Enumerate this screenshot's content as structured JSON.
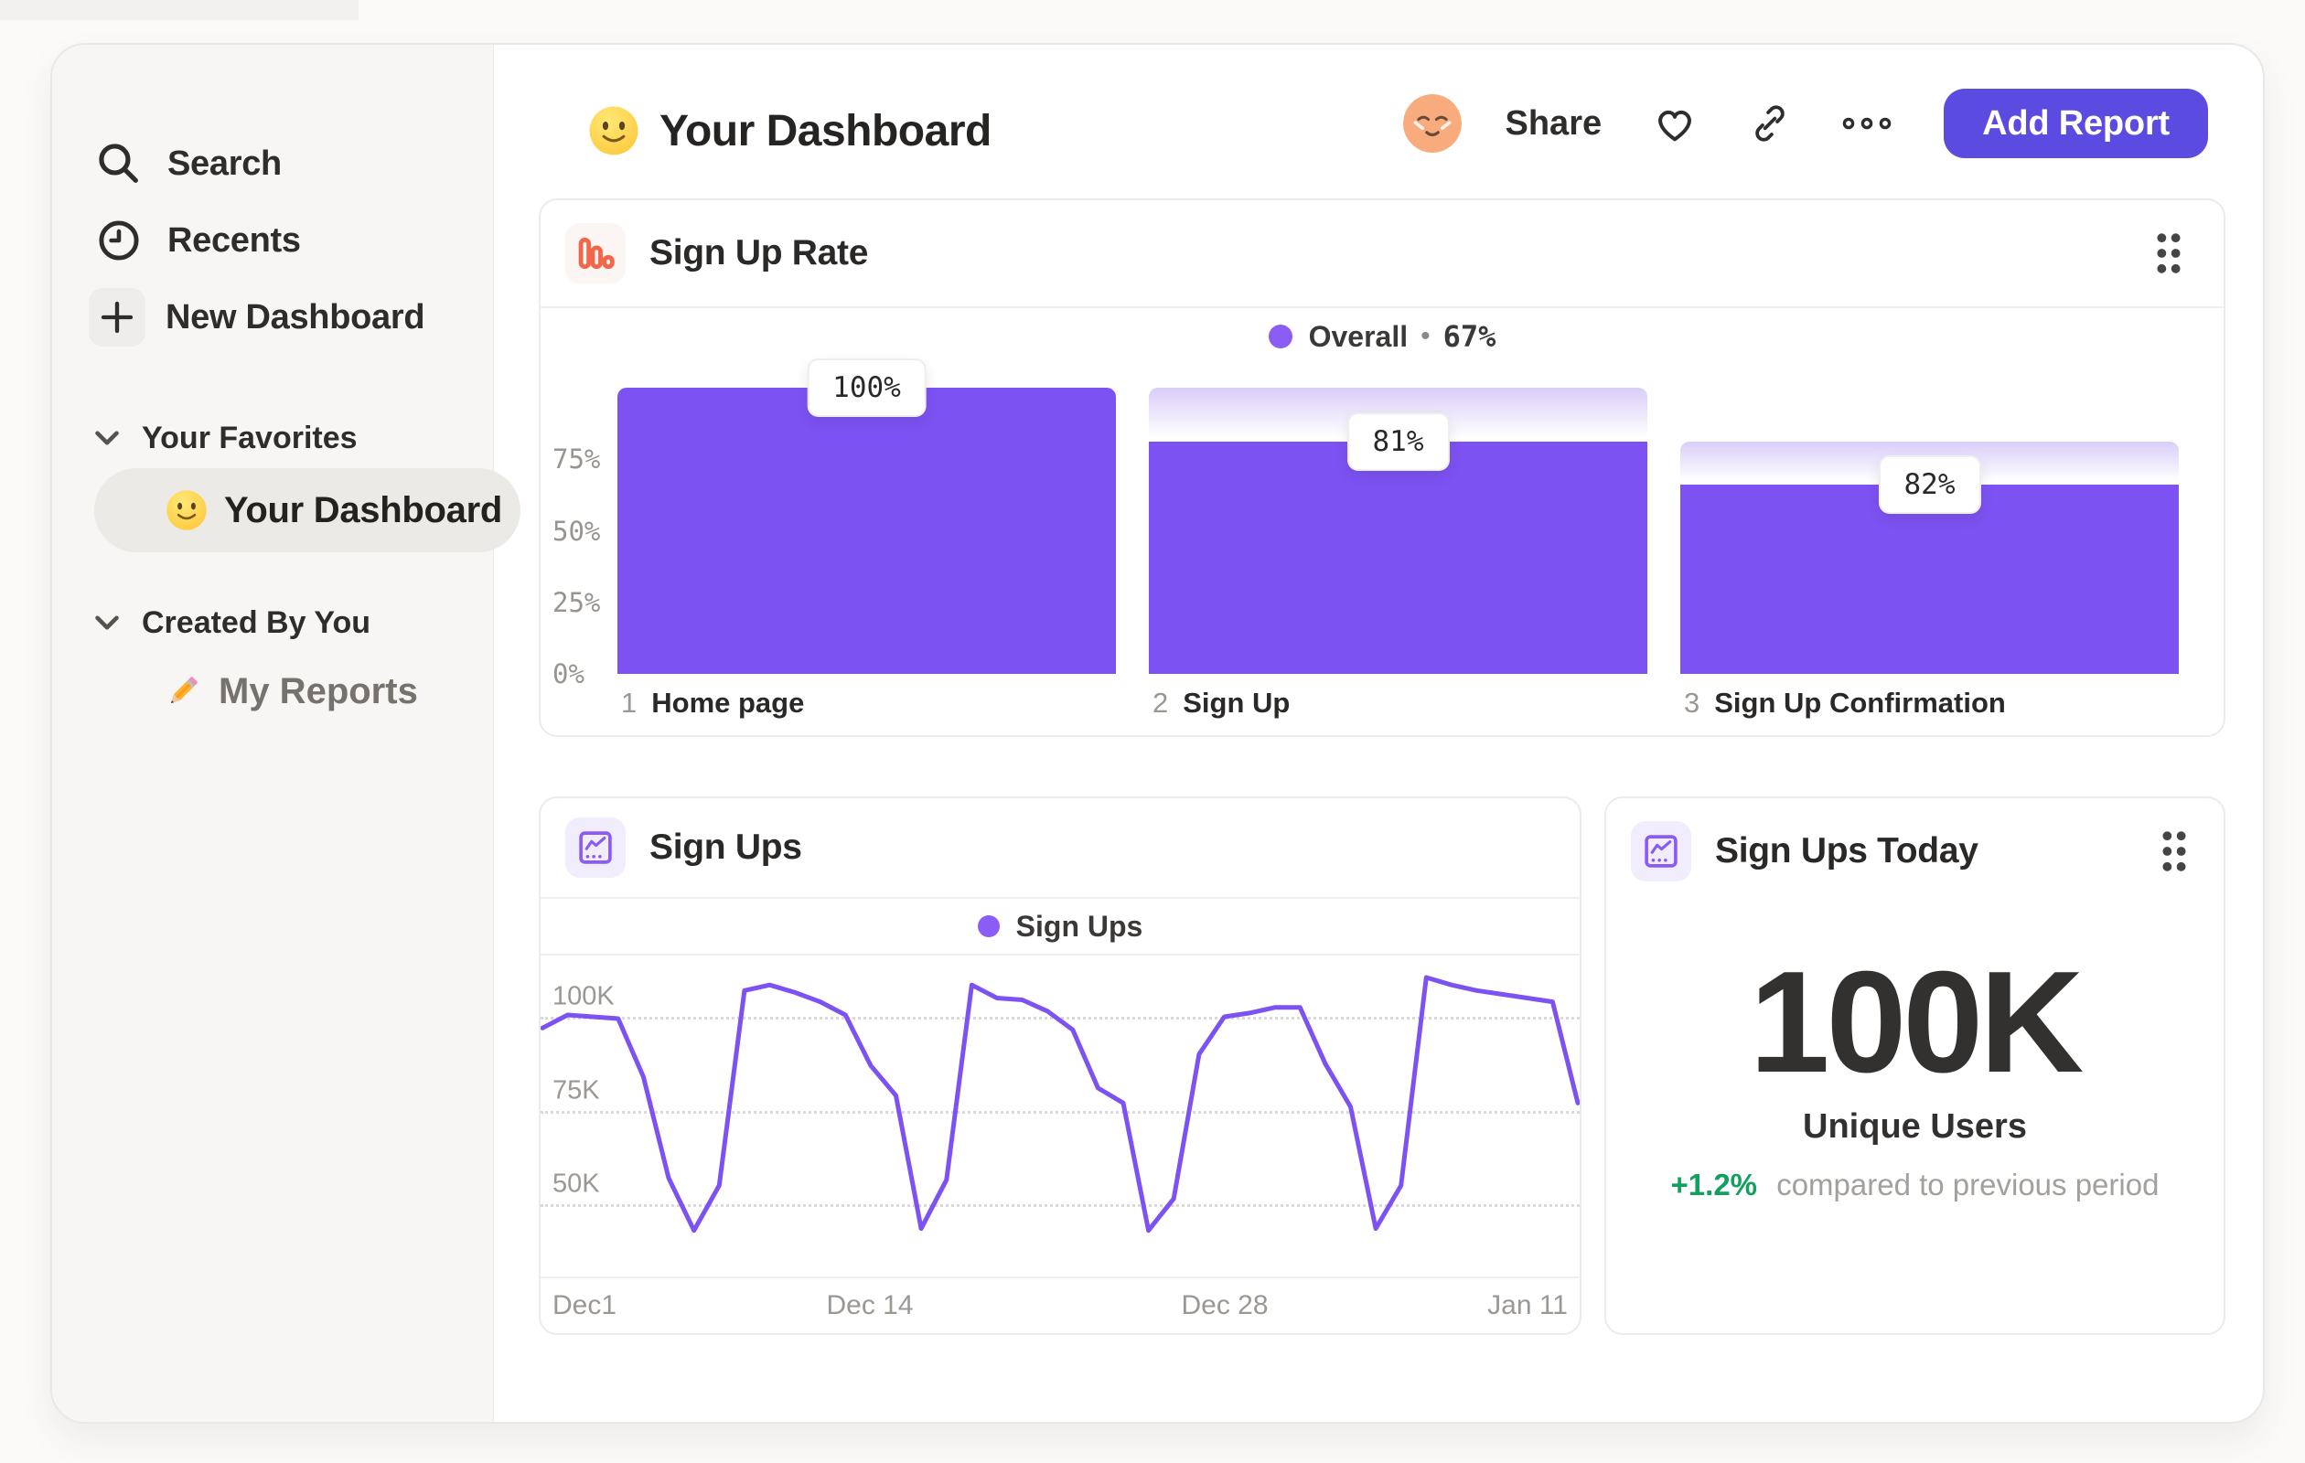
{
  "sidebar": {
    "items": [
      {
        "label": "Search",
        "icon": "search-icon"
      },
      {
        "label": "Recents",
        "icon": "clock-icon"
      },
      {
        "label": "New Dashboard",
        "icon": "plus-icon"
      }
    ],
    "favorites_group": {
      "header": "Your Favorites",
      "item": {
        "label": "Your Dashboard",
        "icon": "smiley-emoji",
        "selected": true
      }
    },
    "created_group": {
      "header": "Created By You",
      "item": {
        "label": "My Reports",
        "icon": "pencil-emoji"
      }
    }
  },
  "header": {
    "title": "Your Dashboard",
    "title_emoji": "slightly-smiling-face",
    "share_label": "Share",
    "icons": [
      "avatar",
      "heart-icon",
      "link-icon",
      "ellipsis-icon"
    ],
    "add_report_label": "Add Report"
  },
  "cards": {
    "funnel": {
      "title": "Sign Up Rate",
      "legend_label": "Overall",
      "legend_separator": "•",
      "legend_value": "67%"
    },
    "signups": {
      "title": "Sign Ups",
      "legend_label": "Sign Ups"
    },
    "today": {
      "title": "Sign Ups Today",
      "value": "100K",
      "label": "Unique Users",
      "delta": "+1.2%",
      "delta_note": "compared to previous period"
    }
  },
  "chart_data": [
    {
      "type": "bar",
      "title": "Sign Up Rate",
      "legend": [
        "Overall"
      ],
      "legend_position": "top-center",
      "overall_conversion_pct": 67,
      "categories": [
        "Home page",
        "Sign Up",
        "Sign Up Confirmation"
      ],
      "step_numbers": [
        "1",
        "2",
        "3"
      ],
      "step_conversion_pct": [
        100,
        81,
        82
      ],
      "cumulative_pct": [
        100,
        81,
        66
      ],
      "prev_cumulative_pct": [
        100,
        100,
        81
      ],
      "data_labels": [
        "100%",
        "81%",
        "82%"
      ],
      "ytick_labels": [
        "75%",
        "50%",
        "25%",
        "0%"
      ],
      "ytick_values": [
        75,
        50,
        25,
        0
      ],
      "ylim": [
        0,
        100
      ],
      "grid": false,
      "bar_color": "#7C52F3",
      "fade_top_color": "#D9CDF8"
    },
    {
      "type": "line",
      "title": "Sign Ups",
      "legend": [
        "Sign Ups"
      ],
      "legend_position": "top-center",
      "xlabel": "",
      "ylabel": "",
      "x_tick_labels": [
        "Dec1",
        "Dec 14",
        "Dec 28",
        "Jan 11"
      ],
      "x_tick_day_index": [
        0,
        13,
        27,
        41
      ],
      "ytick_labels": [
        "100K",
        "75K",
        "50K"
      ],
      "ytick_values": [
        100,
        75,
        50
      ],
      "unit": "K",
      "grid": "dotted-horizontal",
      "values_k": [
        97,
        100.5,
        100,
        99.5,
        84,
        57,
        43,
        55,
        107,
        108.5,
        106.5,
        104,
        100.5,
        87,
        79,
        43.5,
        56.5,
        108.5,
        105,
        104.5,
        101.5,
        96.5,
        81,
        77,
        43,
        51.5,
        90,
        100,
        101,
        102.5,
        102.5,
        87.5,
        76,
        43.5,
        55,
        110.5,
        108.5,
        107,
        106,
        105,
        104,
        77
      ],
      "line_color": "#7C52F3"
    }
  ],
  "colors": {
    "accent_purple": "#7C52F3",
    "legend_dot_purple": "#8B5CF6",
    "button_purple": "#5B4BE1",
    "icon_orange": "#F2674A",
    "positive_green": "#12A05E",
    "sidebar_bg": "#F7F6F5",
    "card_border": "#EDEBE9"
  }
}
